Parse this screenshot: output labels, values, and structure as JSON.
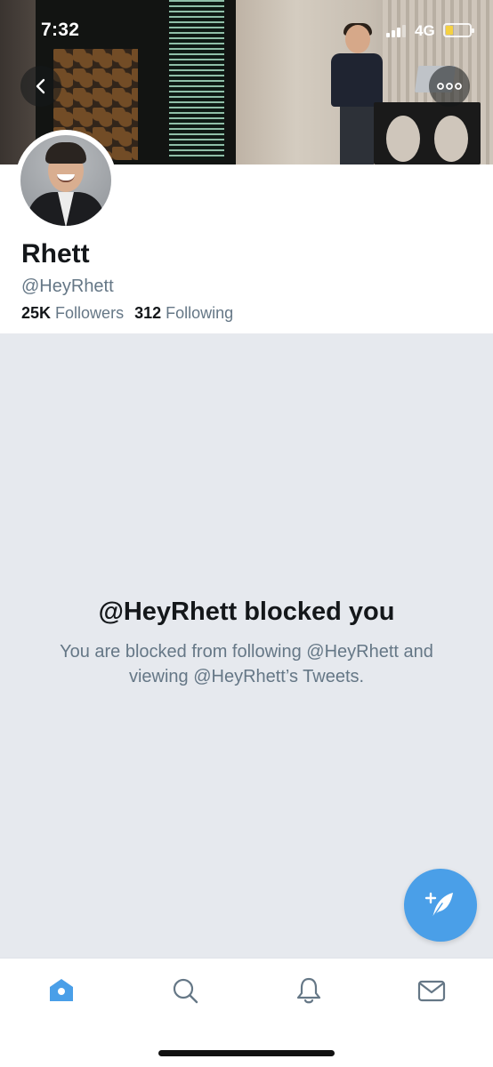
{
  "status_bar": {
    "time": "7:32",
    "network": "4G",
    "battery_color": "#f5d142"
  },
  "header": {
    "back_icon": "chevron-left-icon",
    "more_icon": "more-horizontal-icon"
  },
  "profile": {
    "name": "Rhett",
    "handle": "@HeyRhett",
    "followers_count": "25K",
    "followers_label": "Followers",
    "following_count": "312",
    "following_label": "Following"
  },
  "blocked": {
    "title": "@HeyRhett blocked you",
    "description": "You are blocked from following @HeyRhett and viewing @HeyRhett’s Tweets."
  },
  "fab": {
    "icon": "compose-tweet-icon",
    "color": "#4a9fe8"
  },
  "tabbar": {
    "items": [
      {
        "name": "home",
        "icon": "home-icon",
        "active": true
      },
      {
        "name": "search",
        "icon": "search-icon",
        "active": false
      },
      {
        "name": "notifications",
        "icon": "bell-icon",
        "active": false
      },
      {
        "name": "messages",
        "icon": "mail-icon",
        "active": false
      }
    ],
    "active_color": "#4a9fe8",
    "inactive_color": "#657786"
  }
}
